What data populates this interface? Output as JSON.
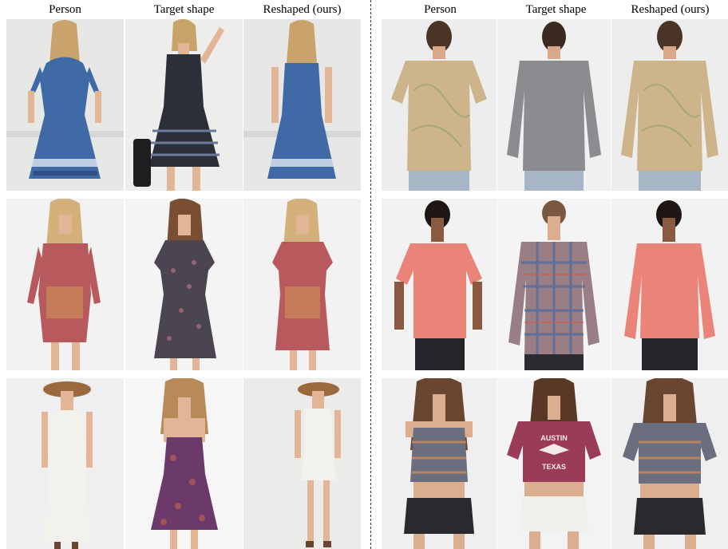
{
  "columns": [
    "Person",
    "Target shape",
    "Reshaped (ours)"
  ],
  "left_panel": {
    "rows": [
      {
        "person": "blue patterned short-sleeve dress, back view",
        "target": "black striped sleeveless dress",
        "reshaped": "blue patterned sleeveless dress"
      },
      {
        "person": "red paisley wrap dress",
        "target": "dark floral short-sleeve dress",
        "reshaped": "red paisley short-sleeve dress"
      },
      {
        "person": "white long sleeveless dress with hat",
        "target": "purple printed strappy dress",
        "reshaped": "white short sleeveless dress"
      }
    ]
  },
  "right_panel": {
    "rows": [
      {
        "person": "map-print tee, back view",
        "target": "grey long-sleeve tee",
        "reshaped": "map-print long-sleeve tee"
      },
      {
        "person": "salmon v-neck tee",
        "target": "plaid button-down shirt",
        "reshaped": "salmon long-sleeve top"
      },
      {
        "person": "patterned tank crop top",
        "target": "maroon graphic crop tee",
        "reshaped": "patterned short-sleeve top"
      }
    ],
    "graphic_text": [
      "AUSTIN",
      "TEXAS"
    ]
  },
  "colors": {
    "bg_gray": "#e9e9e8",
    "blue_dress": "#3f6aa6",
    "black_dress": "#2b2f3a",
    "red_dress": "#b85a5d",
    "dark_floral": "#4a4550",
    "white_dress": "#f3f1ec",
    "purple_dress": "#6b3a6a",
    "map_print": "#cdb48a",
    "grey_tee": "#8a8c8f",
    "salmon": "#ea8478",
    "plaid": "#9a7e86",
    "crop_pattern": "#6a6e7e",
    "maroon": "#9a3c58",
    "skin": "#e3b597",
    "hair_blonde": "#c8a46a",
    "hair_brown": "#6a4530",
    "hair_dark": "#2a1e18",
    "denim_dark": "#2a2a2e",
    "denim_light": "#f0efe9",
    "jeans": "#a7b6c6"
  }
}
